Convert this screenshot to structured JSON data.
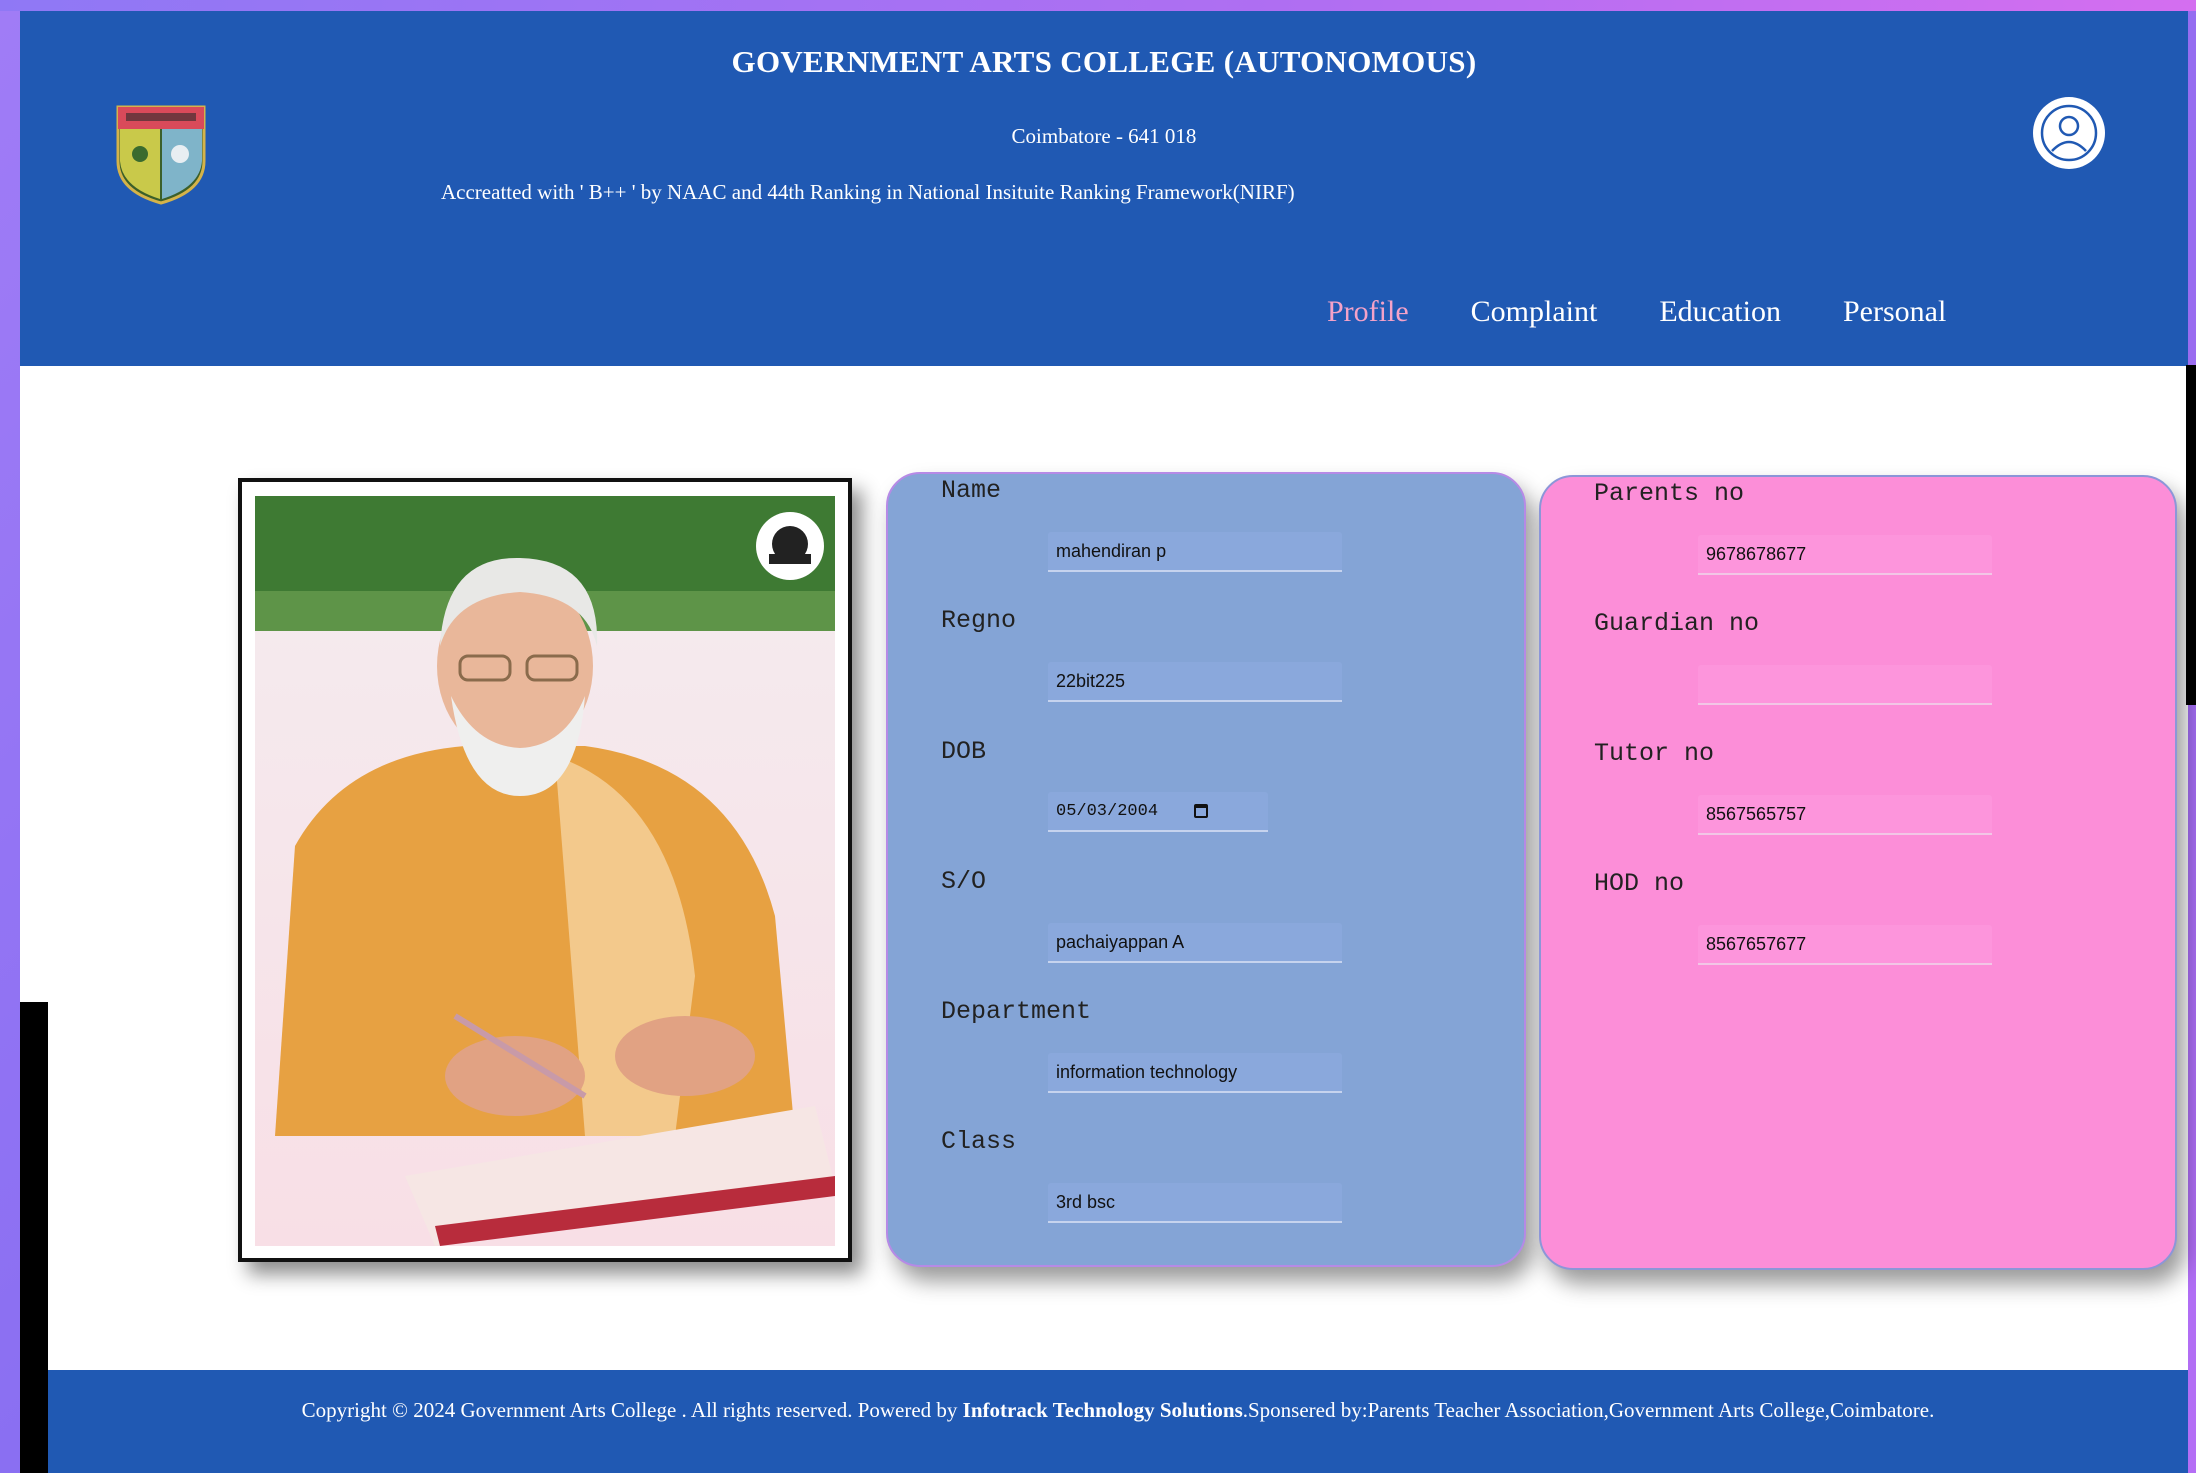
{
  "header": {
    "title": "GOVERNMENT ARTS COLLEGE (AUTONOMOUS)",
    "city": "Coimbatore - 641 018",
    "accreditation": "Accreatted with ' B++ ' by NAAC and 44th Ranking in National Insituite Ranking Framework(NIRF)",
    "logo_icon": "college-crest-icon",
    "profile_icon": "user-avatar-icon"
  },
  "nav": {
    "items": [
      {
        "label": "Profile",
        "active": true
      },
      {
        "label": "Complaint",
        "active": false
      },
      {
        "label": "Education",
        "active": false
      },
      {
        "label": "Personal",
        "active": false
      }
    ]
  },
  "student": {
    "fields": [
      {
        "label": "Name",
        "value": "mahendiran p"
      },
      {
        "label": "Regno",
        "value": "22bit225"
      },
      {
        "label": "DOB",
        "value": "05/03/2004"
      },
      {
        "label": "S/O",
        "value": "pachaiyappan A"
      },
      {
        "label": "Department",
        "value": "information technology"
      },
      {
        "label": "Class",
        "value": "3rd bsc"
      }
    ]
  },
  "contacts": {
    "fields": [
      {
        "label": "Parents no",
        "value": "9678678677"
      },
      {
        "label": "Guardian no",
        "value": ""
      },
      {
        "label": "Tutor no",
        "value": "8567565757"
      },
      {
        "label": "HOD no",
        "value": "8567657677"
      }
    ]
  },
  "footer": {
    "prefix": "Copyright © 2024 Government Arts College . All rights reserved. Powered by ",
    "company": "Infotrack Technology Solutions",
    "suffix": ".Sponsered by:Parents Teacher Association,Government Arts College,Coimbatore."
  },
  "colors": {
    "header_bg": "#2059b3",
    "nav_active": "#f4a2c8",
    "student_card": "#84a4d6",
    "contact_card": "#fc8ed8"
  }
}
